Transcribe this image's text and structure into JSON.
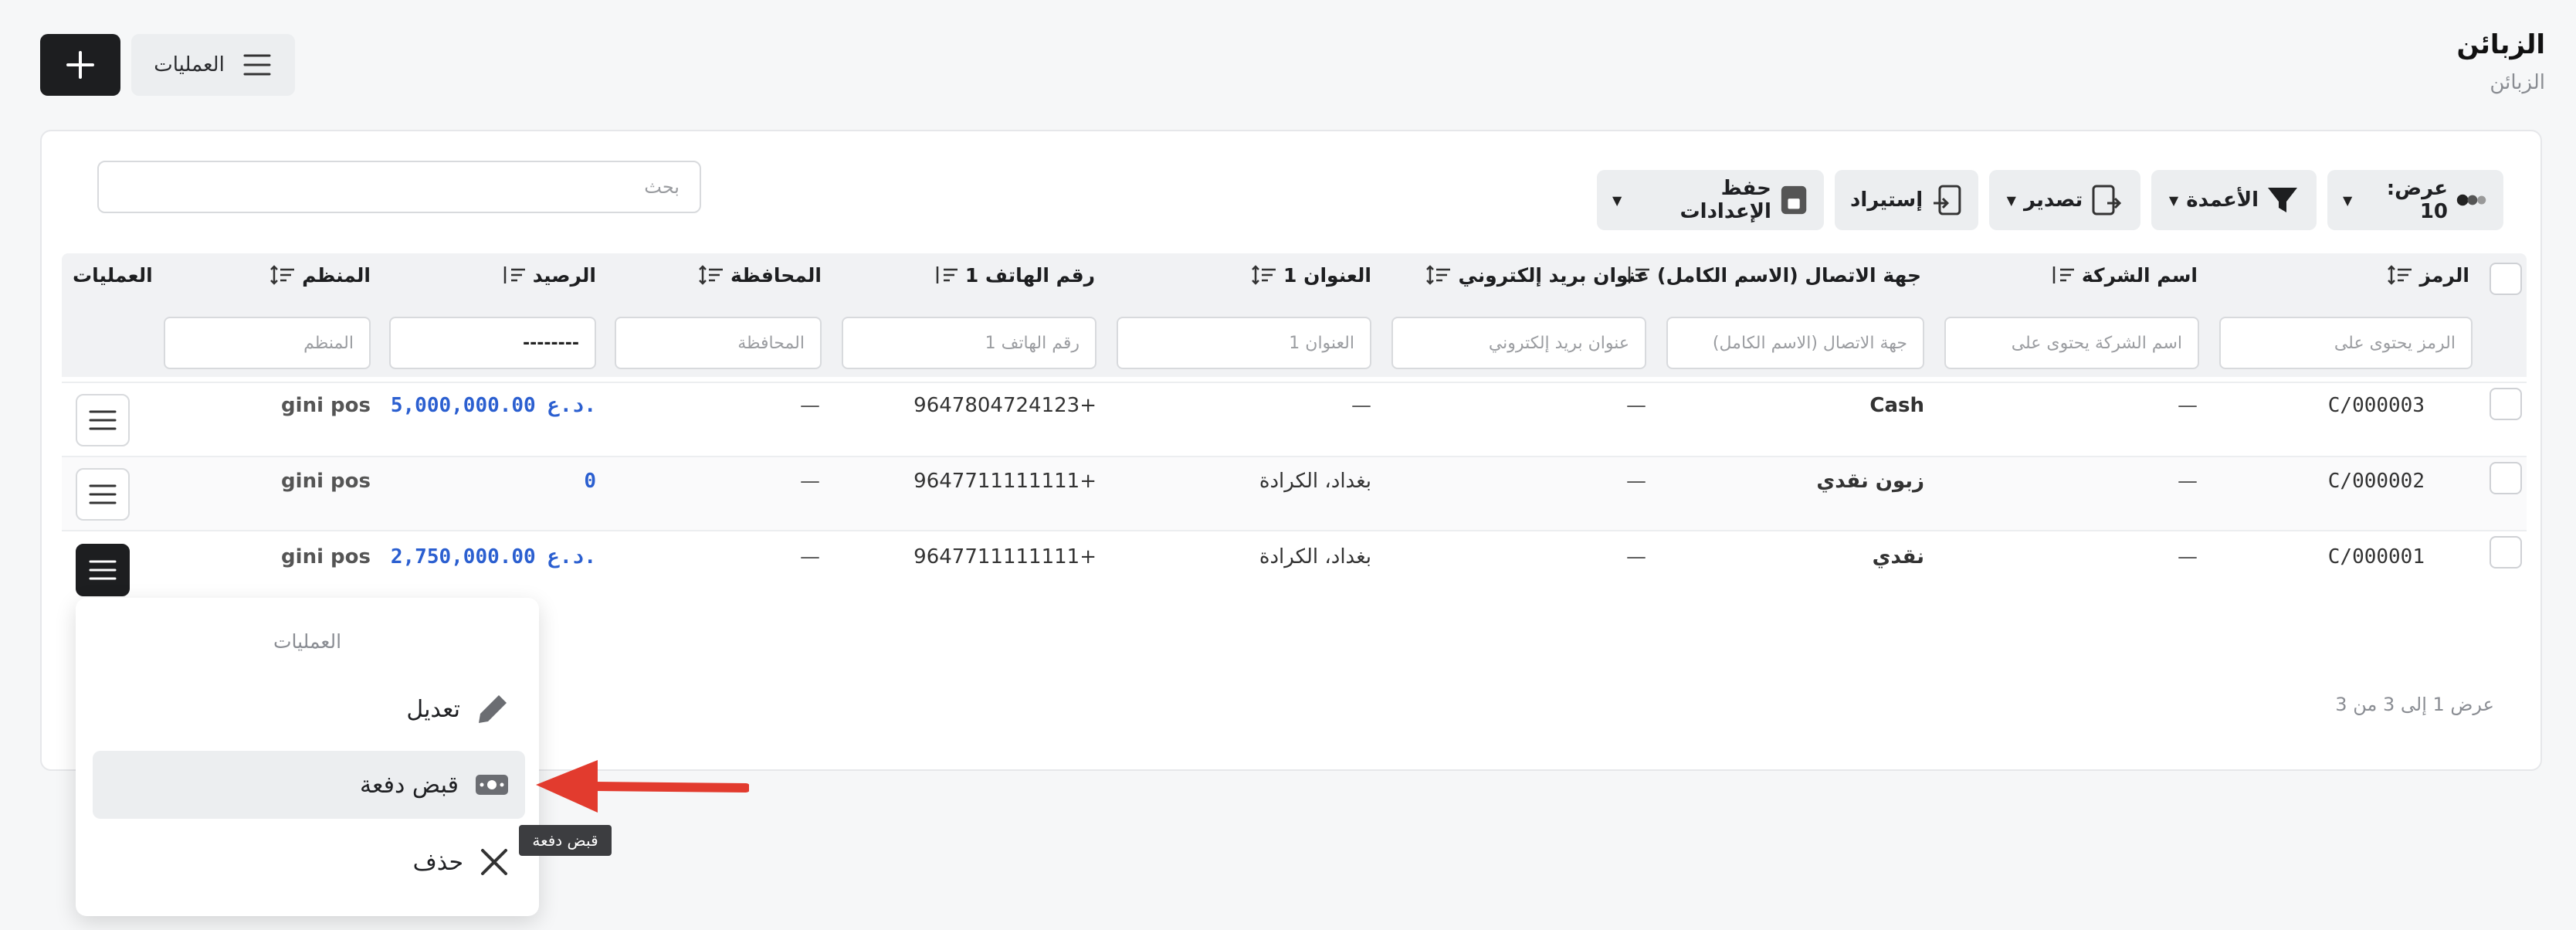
{
  "header": {
    "title": "الزبائن",
    "breadcrumb": "الزبائن",
    "operations_label": "العمليات"
  },
  "toolbar": {
    "show_label": "عرض: 10",
    "columns_label": "الأعمدة",
    "export_label": "تصدير",
    "import_label": "إستيراد",
    "save_settings_label": "حفظ الإعدادات",
    "search_placeholder": "بحث"
  },
  "table": {
    "headers": {
      "code": "الرمز",
      "company": "اسم الشركة",
      "contact": "جهة الاتصال (الاسم الكامل)",
      "email": "عنوان بريد إلكتروني",
      "address1": "العنوان 1",
      "phone1": "رقم الهاتف 1",
      "governorate": "المحافظة",
      "balance": "الرصيد",
      "organizer": "المنظم",
      "operations": "العمليات"
    },
    "filters": {
      "code": "الرمز يحتوى على",
      "company": "اسم الشركة يحتوى على",
      "contact": "جهة الاتصال (الاسم الكامل)",
      "email": "عنوان بريد إلكتروني",
      "address1": "العنوان 1",
      "phone1": "رقم الهاتف 1",
      "governorate": "المحافظة",
      "balance_value": "--------",
      "organizer": "المنظم"
    },
    "rows": [
      {
        "code": "C/000003",
        "company": "—",
        "contact": "Cash",
        "email": "—",
        "address1": "—",
        "phone1": "+9647804724123",
        "governorate": "—",
        "balance": "5,000,000.00 د.ع.",
        "organizer": "gini pos"
      },
      {
        "code": "C/000002",
        "company": "—",
        "contact": "زبون نقدي",
        "email": "—",
        "address1": "بغداد، الكرادة",
        "phone1": "+9647711111111",
        "governorate": "—",
        "balance": "0",
        "organizer": "gini pos"
      },
      {
        "code": "C/000001",
        "company": "—",
        "contact": "نقدي",
        "email": "—",
        "address1": "بغداد، الكرادة",
        "phone1": "+9647711111111",
        "governorate": "—",
        "balance": "2,750,000.00 د.ع.",
        "organizer": "gini pos"
      }
    ]
  },
  "pager": {
    "info": "عرض 1 إلى 3 من 3"
  },
  "dropdown": {
    "title": "العمليات",
    "edit": "تعديل",
    "receive_payment": "قبض دفعة",
    "delete": "حذف",
    "tooltip": "قبض دفعة"
  },
  "colors": {
    "accent_blue": "#2b5fd0",
    "dark_button": "#1d1e20",
    "arrow_red": "#e23b2e"
  }
}
